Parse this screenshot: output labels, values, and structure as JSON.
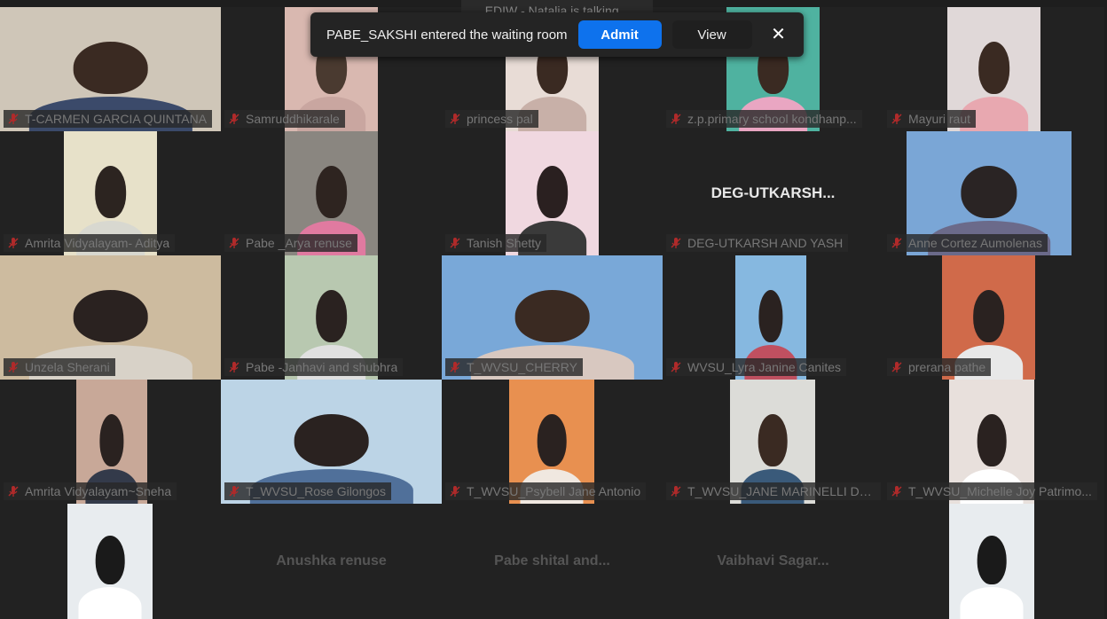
{
  "banner": {
    "message": "PABE_SAKSHI entered the waiting room",
    "admit_label": "Admit",
    "view_label": "View",
    "close_glyph": "✕"
  },
  "talking_indicator": "EDIW - Natalia is talking...",
  "colors": {
    "admit_blue": "#0e72ed",
    "muted_red": "#b02a2a",
    "tile_bg": "#222222"
  },
  "participants": [
    {
      "name": "T-CARMEN GARCIA QUINTANA",
      "video": true,
      "muted": true
    },
    {
      "name": "Samruddhikarale",
      "video": true,
      "muted": true
    },
    {
      "name": "princess pal",
      "video": true,
      "muted": true
    },
    {
      "name": "z.p.primary school kondhanp...",
      "video": true,
      "muted": true
    },
    {
      "name": "Mayuri raut",
      "video": true,
      "muted": true
    },
    {
      "name": "Amrita Vidyalayam- Aditya",
      "video": true,
      "muted": true
    },
    {
      "name": "Pabe _Arya renuse",
      "video": true,
      "muted": true
    },
    {
      "name": "Tanish Shetty",
      "video": true,
      "muted": true
    },
    {
      "name": "DEG-UTKARSH AND YASH",
      "video": false,
      "muted": true,
      "big_name": "DEG-UTKARSH..."
    },
    {
      "name": "Anne Cortez Aumolenas",
      "video": true,
      "muted": true
    },
    {
      "name": "Unzela Sherani",
      "video": true,
      "muted": true
    },
    {
      "name": "Pabe -Janhavi and shubhra",
      "video": true,
      "muted": true
    },
    {
      "name": "T_WVSU_CHERRY",
      "video": true,
      "muted": true
    },
    {
      "name": "WVSU_Lyra Janine Canites",
      "video": true,
      "muted": true
    },
    {
      "name": "prerana pathe",
      "video": true,
      "muted": true
    },
    {
      "name": "Amrita Vidyalayam~Sneha",
      "video": true,
      "muted": true
    },
    {
      "name": "T_WVSU_Rose Gilongos",
      "video": true,
      "muted": true
    },
    {
      "name": "T_WVSU_Psybell Jane Antonio",
      "video": true,
      "muted": true
    },
    {
      "name": "T_WVSU_JANE MARINELLI DA...",
      "video": true,
      "muted": true
    },
    {
      "name": "T_WVSU_Michelle Joy Patrimo...",
      "video": true,
      "muted": true
    },
    {
      "name": "",
      "video": true,
      "muted": false
    },
    {
      "name": "",
      "video": false,
      "muted": false,
      "big_name": "Anushka renuse"
    },
    {
      "name": "",
      "video": false,
      "muted": false,
      "big_name": "Pabe shital and..."
    },
    {
      "name": "",
      "video": false,
      "muted": false,
      "big_name": "Vaibhavi Sagar..."
    },
    {
      "name": "",
      "video": true,
      "muted": false
    }
  ]
}
